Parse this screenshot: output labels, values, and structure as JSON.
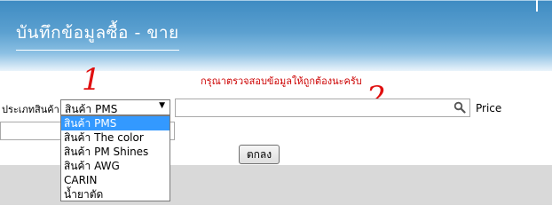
{
  "header": {
    "title": "บันทึกข้อมูลซื้อ - ขาย"
  },
  "form": {
    "warning": "กรุณาตรวจสอบข้อมูลให้ถูกต้องนะครับ",
    "product_type_label": "ประเภทสินค้า",
    "product_type_selected": "สินค้า PMS",
    "product_type_options": [
      "สินค้า PMS",
      "สินค้า The color",
      "สินค้า PM Shines",
      "สินค้า AWG",
      "CARIN",
      "น้ำยาตัด"
    ],
    "search_value": "",
    "price_label": "Price",
    "ok_button": "ตกลง"
  },
  "annotations": {
    "mark1": "1",
    "mark2": "2"
  },
  "colors": {
    "header_blue": "#3e8bc2",
    "warning_red": "#cc0000",
    "selection_blue": "#3399ff",
    "annotation_red": "#e01010"
  },
  "icons": {
    "search": "search-icon",
    "dropdown_arrow": "triangle-down-icon"
  }
}
